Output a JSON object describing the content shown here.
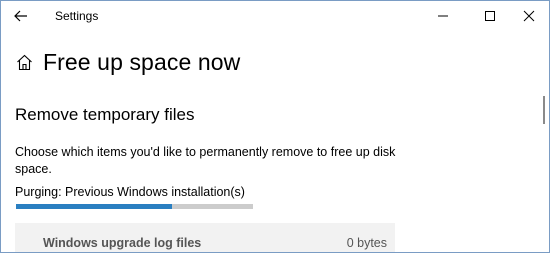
{
  "window": {
    "title": "Settings",
    "back_icon": "back-arrow-icon",
    "minimize_icon": "minimize-icon",
    "maximize_icon": "maximize-icon",
    "close_icon": "close-icon"
  },
  "header": {
    "icon": "home-icon",
    "title": "Free up space now"
  },
  "section": {
    "title": "Remove temporary files",
    "description": "Choose which items you'd like to permanently remove to free up disk space.",
    "status": "Purging: Previous Windows installation(s)",
    "progress_fraction": 0.66
  },
  "items": [
    {
      "label": "Windows upgrade log files",
      "size": "0 bytes"
    }
  ],
  "colors": {
    "accent": "#2a7fc1",
    "progress_track": "#cccccc",
    "row_background": "#f2f2f2"
  }
}
